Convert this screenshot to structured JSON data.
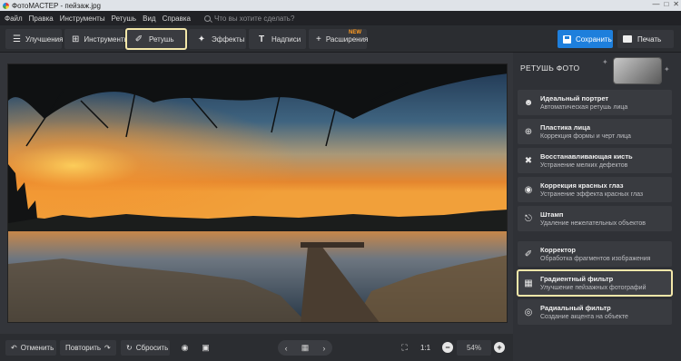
{
  "window": {
    "title": "ФотоМАСТЕР - пейзаж.jpg"
  },
  "menu": {
    "items": [
      "Файл",
      "Правка",
      "Инструменты",
      "Ретушь",
      "Вид",
      "Справка"
    ],
    "search_placeholder": "Что вы хотите сделать?"
  },
  "toolbar": {
    "tabs": [
      {
        "label": "Улучшения",
        "icon": "sliders-icon"
      },
      {
        "label": "Инструменты",
        "icon": "crop-icon"
      },
      {
        "label": "Ретушь",
        "icon": "brush-icon",
        "active": true
      },
      {
        "label": "Эффекты",
        "icon": "magic-wand-icon"
      },
      {
        "label": "Надписи",
        "icon": "text-icon"
      },
      {
        "label": "Расширения",
        "icon": "plus-icon",
        "badge": "NEW"
      }
    ],
    "save_label": "Сохранить",
    "print_label": "Печать"
  },
  "panel": {
    "title": "РЕТУШЬ ФОТО",
    "items": [
      {
        "title": "Идеальный портрет",
        "desc": "Автоматическая ретушь лица",
        "icon": "face-icon"
      },
      {
        "title": "Пластика лица",
        "desc": "Коррекция формы и черт лица",
        "icon": "target-icon"
      },
      {
        "title": "Восстанавливающая кисть",
        "desc": "Устранение мелких дефектов",
        "icon": "bandage-icon"
      },
      {
        "title": "Коррекция красных глаз",
        "desc": "Устранение эффекта красных глаз",
        "icon": "eye-icon"
      },
      {
        "title": "Штамп",
        "desc": "Удаление нежелательных объектов",
        "icon": "stamp-icon"
      },
      {
        "title": "Корректор",
        "desc": "Обработка фрагментов изображения",
        "icon": "brush-icon"
      },
      {
        "title": "Градиентный фильтр",
        "desc": "Улучшение пейзажных фотографий",
        "icon": "gradient-icon",
        "active": true
      },
      {
        "title": "Радиальный фильтр",
        "desc": "Создание акцента на объекте",
        "icon": "radial-icon"
      }
    ]
  },
  "bottombar": {
    "undo_label": "Отменить",
    "redo_label": "Повторить",
    "reset_label": "Сбросить",
    "ratio_label": "1:1",
    "zoom": "54%"
  },
  "colors": {
    "accent": "#1e7fdc",
    "highlight": "#f3e7a9",
    "badge": "#ff9b21"
  }
}
